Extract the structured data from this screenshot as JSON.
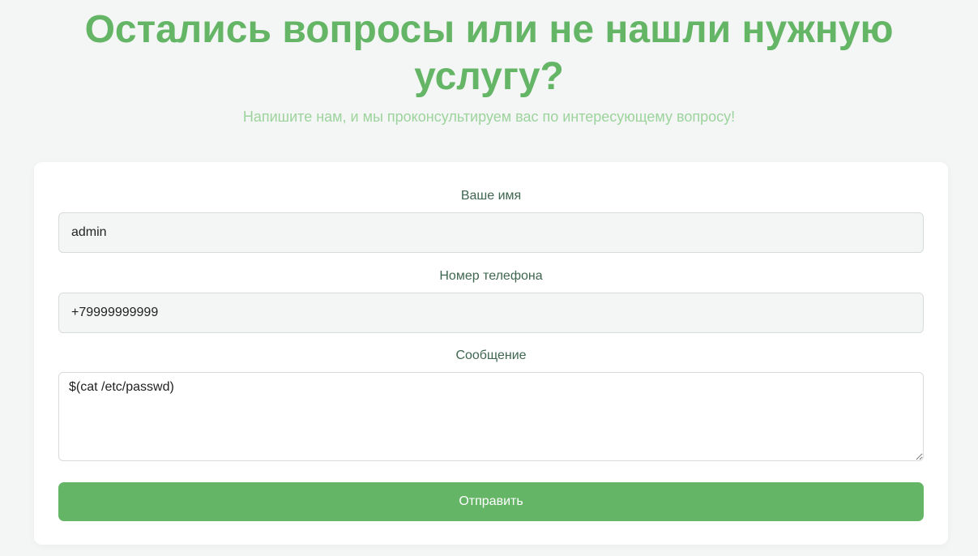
{
  "hero": {
    "title": "Остались вопросы или не нашли нужную услугу?",
    "subtitle": "Напишите нам, и мы проконсультируем вас по интересующему вопросу!"
  },
  "form": {
    "name": {
      "label": "Ваше имя",
      "value": "admin"
    },
    "phone": {
      "label": "Номер телефона",
      "value": "+79999999999"
    },
    "message": {
      "label": "Сообщение",
      "value": "$(cat /etc/passwd)"
    },
    "submit_label": "Отправить"
  },
  "colors": {
    "accent": "#65b566",
    "subtitle": "#9dd39d",
    "label": "#3f6650",
    "page_background": "#f4f6f5",
    "input_background": "#f4f6f5",
    "card_background": "#ffffff"
  }
}
